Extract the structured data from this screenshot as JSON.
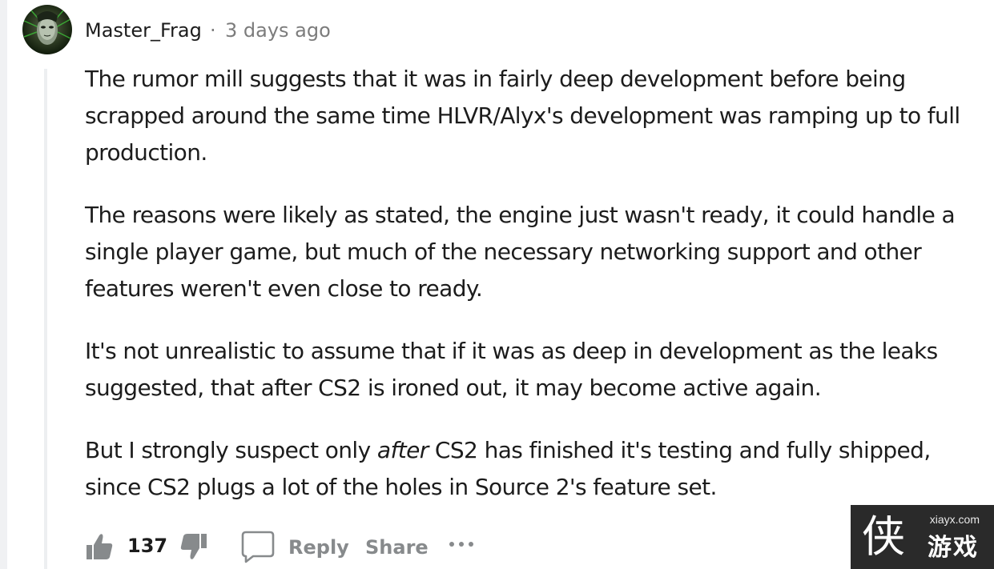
{
  "comment": {
    "author": "Master_Frag",
    "separator": "·",
    "timestamp": "3 days ago",
    "paragraphs": [
      "The rumor mill suggests that it was in fairly deep development before being scrapped around the same time HLVR/Alyx's development was ramping up to full production.",
      "The reasons were likely as stated, the engine just wasn't ready, it could handle a single player game, but much of the necessary networking support and other features weren't even close to ready.",
      "It's not unrealistic to assume that if it was as deep in development as the leaks suggested, that after CS2 is ironed out, it may become active again."
    ],
    "last_paragraph": {
      "before": "But I strongly suspect only ",
      "emphasis": "after",
      "after": " CS2 has finished it's testing and fully shipped, since CS2 plugs a lot of the holes in Source 2's feature set."
    }
  },
  "actions": {
    "score": "137",
    "reply_label": "Reply",
    "share_label": "Share",
    "icons": [
      "upvote-icon",
      "downvote-icon",
      "comment-bubble-icon",
      "more-options-icon"
    ]
  },
  "watermark": {
    "site": "xiayx.com",
    "logo_char": "侠",
    "name": "游戏"
  },
  "colors": {
    "text": "#1c1c1c",
    "meta": "#7c7c7c",
    "action": "#878a8c",
    "thread_line": "#edeff1",
    "watermark_bg": "#2a2a2a"
  }
}
